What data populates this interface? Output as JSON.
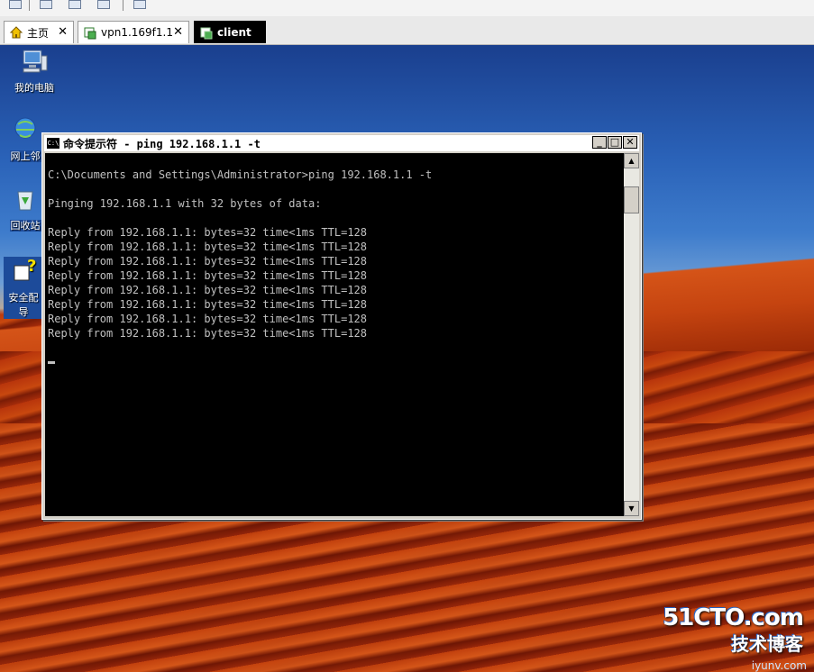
{
  "tabs": [
    {
      "label": "主页",
      "icon": "home-icon",
      "closable": true
    },
    {
      "label": "vpn1.169f1.1",
      "icon": "vm-icon",
      "closable": true
    },
    {
      "label": "client",
      "icon": "vm-icon",
      "closable": false,
      "active": true
    }
  ],
  "close_glyph": "✕",
  "desktop_icons": [
    {
      "label": "我的电脑",
      "icon": "computer-icon"
    },
    {
      "label": "网上邻",
      "icon": "network-icon"
    },
    {
      "label": "回收站",
      "icon": "recycle-bin-icon"
    },
    {
      "label": "安全配",
      "label2": "导",
      "icon": "security-wizard-icon"
    }
  ],
  "cmd": {
    "title": "命令提示符 - ping 192.168.1.1 -t",
    "icon_text": "C:\\",
    "minimize": "_",
    "maximize": "□",
    "close": "✕",
    "lines": [
      "",
      "C:\\Documents and Settings\\Administrator>ping 192.168.1.1 -t",
      "",
      "Pinging 192.168.1.1 with 32 bytes of data:",
      "",
      "Reply from 192.168.1.1: bytes=32 time<1ms TTL=128",
      "Reply from 192.168.1.1: bytes=32 time<1ms TTL=128",
      "Reply from 192.168.1.1: bytes=32 time<1ms TTL=128",
      "Reply from 192.168.1.1: bytes=32 time<1ms TTL=128",
      "Reply from 192.168.1.1: bytes=32 time<1ms TTL=128",
      "Reply from 192.168.1.1: bytes=32 time<1ms TTL=128",
      "Reply from 192.168.1.1: bytes=32 time<1ms TTL=128",
      "Reply from 192.168.1.1: bytes=32 time<1ms TTL=128"
    ],
    "scroll_up": "▲",
    "scroll_down": "▼"
  },
  "watermark": {
    "main": "51CTO.com",
    "sub": "技术博客",
    "url": "iyunv.com"
  },
  "colors": {
    "console_bg": "#000000",
    "console_fg": "#c0c0c0",
    "active_tab_bg": "#000000"
  }
}
